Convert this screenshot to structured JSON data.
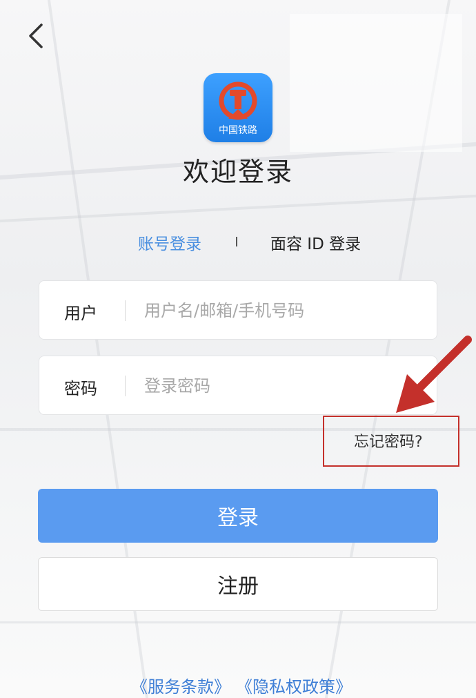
{
  "header": {
    "back_icon": "chevron-left-icon"
  },
  "logo": {
    "text": "中国铁路",
    "icon": "china-railway-logo-icon",
    "bg_color": "#2a8ef5",
    "emblem_color": "#e24a2c"
  },
  "title": "欢迎登录",
  "tabs": [
    {
      "label": "账号登录",
      "active": true,
      "color": "#4a8fe0"
    },
    {
      "label": "面容 ID 登录",
      "active": false
    }
  ],
  "form": {
    "username": {
      "label": "用户",
      "value": "",
      "placeholder": "用户名/邮箱/手机号码"
    },
    "password": {
      "label": "密码",
      "value": "",
      "placeholder": "登录密码"
    },
    "forgot_label": "忘记密码?"
  },
  "annotation": {
    "color": "#c4302b",
    "shape": "arrow-and-box"
  },
  "buttons": {
    "login_label": "登录",
    "login_color": "#5a9bf0",
    "register_label": "注册"
  },
  "footer": {
    "terms_label": "《服务条款》",
    "privacy_label": "《隐私权政策》",
    "link_color": "#3f7fd6"
  }
}
